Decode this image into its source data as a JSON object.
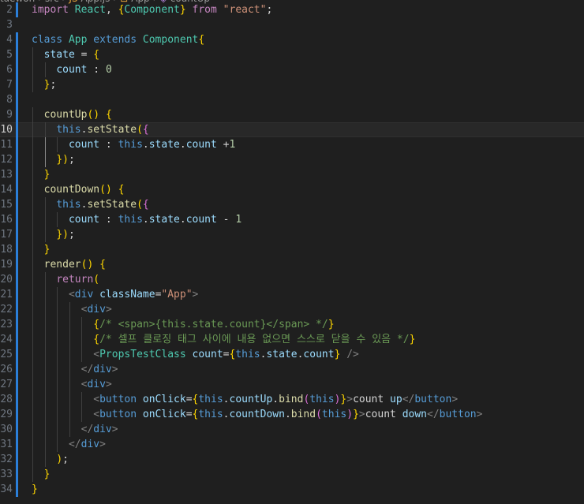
{
  "breadcrumb": {
    "items": [
      {
        "label": "taewon",
        "icon": "folder-icon"
      },
      {
        "label": "src",
        "icon": "folder-icon"
      },
      {
        "label": "App.js",
        "icon": "react-file-icon"
      },
      {
        "label": "App",
        "icon": "class-icon"
      },
      {
        "label": "countUp",
        "icon": "method-icon"
      }
    ]
  },
  "lines": [
    {
      "n": "2",
      "t": "import React, {Component} from \"react\";"
    },
    {
      "n": "3",
      "t": ""
    },
    {
      "n": "4",
      "t": "class App extends Component{"
    },
    {
      "n": "5",
      "t": "  state = {"
    },
    {
      "n": "6",
      "t": "    count : 0"
    },
    {
      "n": "7",
      "t": "  };"
    },
    {
      "n": "8",
      "t": ""
    },
    {
      "n": "9",
      "t": "  countUp() {"
    },
    {
      "n": "10",
      "t": "    this.setState({"
    },
    {
      "n": "11",
      "t": "      count : this.state.count +1"
    },
    {
      "n": "12",
      "t": "    });"
    },
    {
      "n": "13",
      "t": "  }"
    },
    {
      "n": "14",
      "t": "  countDown() {"
    },
    {
      "n": "15",
      "t": "    this.setState({"
    },
    {
      "n": "16",
      "t": "      count : this.state.count - 1"
    },
    {
      "n": "17",
      "t": "    });"
    },
    {
      "n": "18",
      "t": "  }"
    },
    {
      "n": "19",
      "t": "  render() {"
    },
    {
      "n": "20",
      "t": "    return("
    },
    {
      "n": "21",
      "t": "      <div className=\"App\">"
    },
    {
      "n": "22",
      "t": "        <div>"
    },
    {
      "n": "23",
      "t": "          {/* <span>{this.state.count}</span> */}"
    },
    {
      "n": "24",
      "t": "          {/* 셀프 클로징 태그 사이에 내용 없으면 스스로 닫을 수 있음 */}"
    },
    {
      "n": "25",
      "t": "          <PropsTestClass count={this.state.count} />"
    },
    {
      "n": "26",
      "t": "        </div>"
    },
    {
      "n": "27",
      "t": "        <div>"
    },
    {
      "n": "28",
      "t": "          <button onClick={this.countUp.bind(this)}>count up</button>"
    },
    {
      "n": "29",
      "t": "          <button onClick={this.countDown.bind(this)}>count down</button>"
    },
    {
      "n": "30",
      "t": "        </div>"
    },
    {
      "n": "31",
      "t": "      </div>"
    },
    {
      "n": "32",
      "t": "    );"
    },
    {
      "n": "33",
      "t": "  }"
    },
    {
      "n": "34",
      "t": "}"
    }
  ],
  "active_line": "10",
  "modified_lines": [
    "2",
    "4",
    "5",
    "6",
    "7",
    "8",
    "9",
    "10",
    "11",
    "12",
    "13",
    "14",
    "15",
    "16",
    "17",
    "18",
    "19",
    "20",
    "21",
    "22",
    "23",
    "24",
    "25",
    "26",
    "27",
    "28",
    "29",
    "30",
    "31",
    "32",
    "33",
    "34"
  ]
}
